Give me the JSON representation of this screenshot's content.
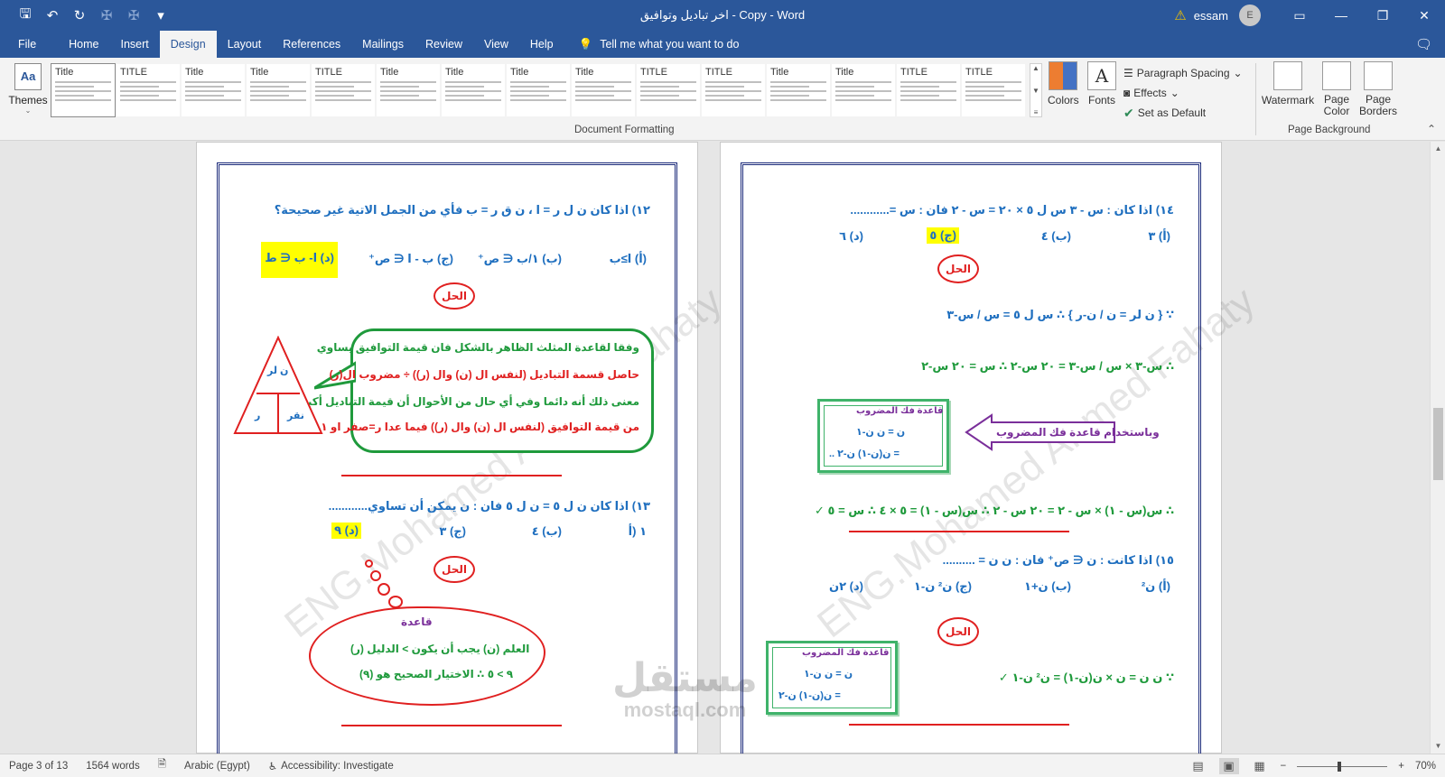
{
  "window": {
    "title": "اخر تباديل وتوافيق - Copy  -  Word",
    "user": "essam",
    "avatar_initial": "E"
  },
  "tabs": [
    "File",
    "Home",
    "Insert",
    "Design",
    "Layout",
    "References",
    "Mailings",
    "Review",
    "View",
    "Help"
  ],
  "active_tab": "Design",
  "tell_me": "Tell me what you want to do",
  "ribbon": {
    "themes_label": "Themes",
    "gallery_titles": [
      "Title",
      "TITLE",
      "Title",
      "Title",
      "TITLE",
      "Title",
      "Title",
      "Title",
      "Title",
      "TITLE",
      "TITLE",
      "Title",
      "Title",
      "TITLE",
      "TITLE"
    ],
    "colors_label": "Colors",
    "fonts_label": "Fonts",
    "paragraph_spacing": "Paragraph Spacing",
    "effects": "Effects",
    "set_default": "Set as Default",
    "document_formatting": "Document Formatting",
    "watermark": "Watermark",
    "page_color": "Page Color",
    "page_borders": "Page Borders",
    "page_background": "Page Background"
  },
  "left_page": {
    "q12": "١٢) اذا كان ن ل ر = ا  ،  ن ق ر = ب   فأي من الجمل الاتية غير صحيحة؟",
    "q12_a": "(أ) ا≥ب",
    "q12_b": "(ب) ١/ب ∈ ص⁺",
    "q12_c": "(ج) ب - ا ∈ ص⁺",
    "q12_d": "(د) ا- ب ∈ ط",
    "solution": "الحل",
    "bubble_1": "وفقا لقاعدة المثلث الظاهر بالشكل فان قيمة التوافيق يساوي",
    "bubble_2": "حاصل قسمة التباديل (لنفس ال (ن) وال (ر)) ÷ مضروب ال(ر)",
    "bubble_3": "معنى ذلك أنه دائما وفي أي حال من الأحوال أن قيمة التباديل أكبر",
    "bubble_4": "من قيمة التوافيق (لنفس ال (ن) وال (ر)) فيما عدا  ر=صفر او  ١",
    "tri_top": "ن لر",
    "tri_left": "ر",
    "tri_right": "نقر",
    "q13": "١٣) اذا كان ن ل ٥ = ن ل ٥   فان : ن يمكن أن تساوي............",
    "q13_a": "١ (أ",
    "q13_b": "(ب) ٤",
    "q13_c": "(ج) ٣",
    "q13_d": "(د) ٩",
    "cloud_title": "قاعدة",
    "cloud_1": "العلم (ن) يجب أن يكون > الدليل (ر)",
    "cloud_2": "٩ > ٥ ∴ الاختيار الصحيح هو (٩)"
  },
  "right_page": {
    "q14": "١٤) اذا كان : س - ٣ س ل ٥ × ٢٠ = س - ٢    فان : س =............",
    "q14_a": "(أ) ٣",
    "q14_b": "(ب) ٤",
    "q14_c": "(ج) ٥",
    "q14_d": "(د) ٦",
    "solution": "الحل",
    "step1": "∵ { ن لر = ن / ن-ر }  ∴  س ل ٥ = س / س-٣",
    "step2": "∴ س-٣ × س / س-٣ = ٢٠ س-٢   ∴  س = ٢٠ س-٢",
    "rule_title": "قاعدة فك المضروب",
    "rule_1": "ن = ن ن-١",
    "rule_2": "= ن(ن-١) ن-٢ ..",
    "arrow_text": "وباستخدام قاعدة فك المضروب",
    "step3": "∴ س(س - ١) × س - ٢ = ٢٠ س - ٢   ∴ س(س - ١) = ٥ × ٤   ∴ س = ٥ ✓",
    "q15": "١٥) اذا كانت : ن ∈ ص⁺   فان : ن ن = ..........",
    "q15_a": "(أ) ن²",
    "q15_b": "(ب) ن+١",
    "q15_c": "(ج) ن² ن-١",
    "q15_d": "(د) ٢ن",
    "rule2_title": "قاعدة فك المضروب",
    "rule2_1": "ن = ن ن-١",
    "rule2_2": "= ن(ن-١) ن-٢",
    "step4": "∵ ن ن = ن × ن(ن-١) = ن² ن-١ ✓",
    "watermark": "ENG.Mohamed Ahmed Fahaty"
  },
  "logo": {
    "ar": "مستقل",
    "en": "mostaql.com"
  },
  "status": {
    "page": "Page 3 of 13",
    "words": "1564 words",
    "language": "Arabic (Egypt)",
    "accessibility": "Accessibility: Investigate",
    "zoom": "70%",
    "zoom_level": 0.47
  },
  "colors": {
    "title_bar": "#2b579a",
    "ribbon": "#f3f3f3",
    "blue_text": "#1f6fbf",
    "green_text": "#1f9a3c",
    "red_text": "#e02020",
    "highlight": "#ffff00"
  }
}
